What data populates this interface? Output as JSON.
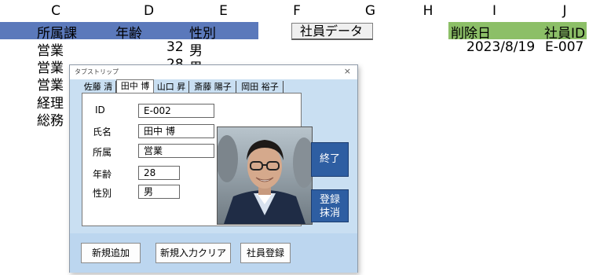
{
  "columns": [
    "C",
    "D",
    "E",
    "F",
    "G",
    "H",
    "I",
    "J"
  ],
  "headers": {
    "dept": "所属課",
    "age": "年齢",
    "gender": "性別",
    "sheet_label": "社員データ",
    "deleted_date": "削除日",
    "employee_id": "社員ID"
  },
  "rows": [
    {
      "dept": "営業",
      "age": "32",
      "gender": "男"
    },
    {
      "dept": "営業",
      "age": "28",
      "gender": "男"
    },
    {
      "dept": "営業"
    },
    {
      "dept": "経理"
    },
    {
      "dept": "総務"
    }
  ],
  "deleted_row": {
    "date": "2023/8/19",
    "id": "E-007"
  },
  "dialog": {
    "title": "タブストリップ",
    "close": "×",
    "tabs": [
      "佐藤 清",
      "田中 博",
      "山口 昇",
      "斎藤 陽子",
      "岡田 裕子"
    ],
    "active_tab": 1,
    "fields": {
      "id_label": "ID",
      "id_value": "E-002",
      "name_label": "氏名",
      "name_value": "田中 博",
      "dept_label": "所属",
      "dept_value": "営業",
      "age_label": "年齢",
      "age_value": "28",
      "gender_label": "性別",
      "gender_value": "男"
    },
    "buttons": {
      "end": "終了",
      "delete_line1": "登録",
      "delete_line2": "抹消",
      "add_new": "新規追加",
      "clear_input": "新規入力クリア",
      "register": "社員登録"
    }
  },
  "colors": {
    "header_blue": "#5b79bb",
    "header_green": "#8cbf67",
    "dialog_bg": "#c9dff2",
    "button_blue": "#2e5ea2"
  }
}
